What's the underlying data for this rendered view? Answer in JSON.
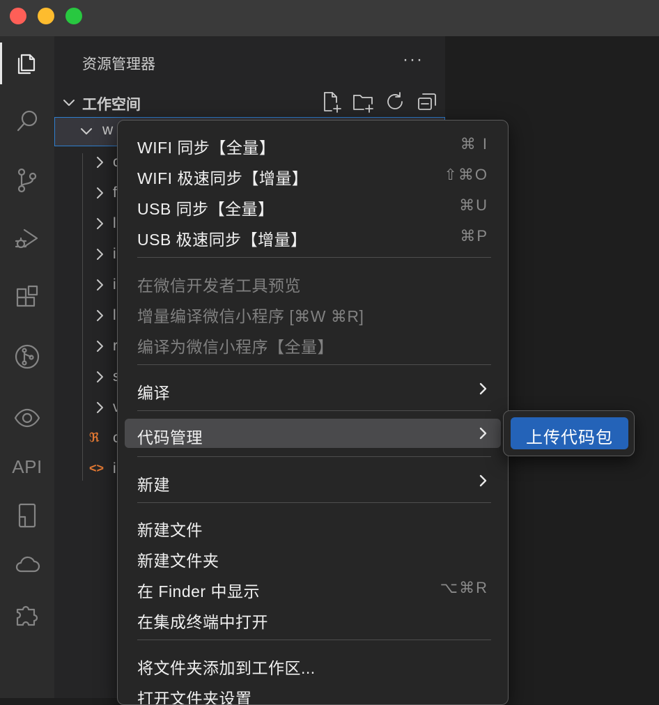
{
  "window": {
    "controls": [
      "close",
      "minimize",
      "zoom"
    ]
  },
  "activity_bar": {
    "items": [
      {
        "name": "files-icon",
        "active": true
      },
      {
        "name": "search-icon"
      },
      {
        "name": "source-control-icon"
      },
      {
        "name": "run-debug-icon"
      },
      {
        "name": "extensions-icon"
      },
      {
        "name": "git-graph-icon"
      },
      {
        "name": "eye-icon"
      },
      {
        "name": "api",
        "label": "API"
      },
      {
        "name": "device-icon"
      },
      {
        "name": "cloud-icon"
      },
      {
        "name": "puzzle-icon"
      }
    ]
  },
  "sidebar": {
    "title": "资源管理器",
    "more": "···",
    "workspace_title": "工作空间",
    "folder_name": "w",
    "tree": [
      "c",
      "f",
      "l",
      "i",
      "i",
      "l",
      "r",
      "s",
      "v",
      "c",
      "i"
    ]
  },
  "context_menu": {
    "items": [
      {
        "label": "WIFI 同步【全量】",
        "shortcut": "⌘ I"
      },
      {
        "label": "WIFI 极速同步【增量】",
        "shortcut": "⇧⌘O"
      },
      {
        "label": "USB 同步【全量】",
        "shortcut": "⌘U"
      },
      {
        "label": "USB 极速同步【增量】",
        "shortcut": "⌘P"
      },
      {
        "label": "在微信开发者工具预览",
        "disabled": true
      },
      {
        "label": "增量编译微信小程序 [⌘W ⌘R]",
        "disabled": true
      },
      {
        "label": "编译为微信小程序【全量】",
        "disabled": true
      },
      {
        "label": "编译",
        "submenu": true
      },
      {
        "label": "代码管理",
        "submenu": true,
        "highlighted": true
      },
      {
        "label": "新建",
        "submenu": true
      },
      {
        "label": "新建文件"
      },
      {
        "label": "新建文件夹"
      },
      {
        "label": "在 Finder 中显示",
        "shortcut": "⌥⌘R"
      },
      {
        "label": "在集成终端中打开"
      },
      {
        "label": "将文件夹添加到工作区..."
      },
      {
        "label": "打开文件夹设置"
      }
    ]
  },
  "submenu": {
    "items": [
      {
        "label": "上传代码包",
        "highlighted": true
      }
    ]
  },
  "colors": {
    "accent": "#2463b8",
    "focus_border": "#2f7fd0",
    "rss_icon": "#e37933"
  }
}
